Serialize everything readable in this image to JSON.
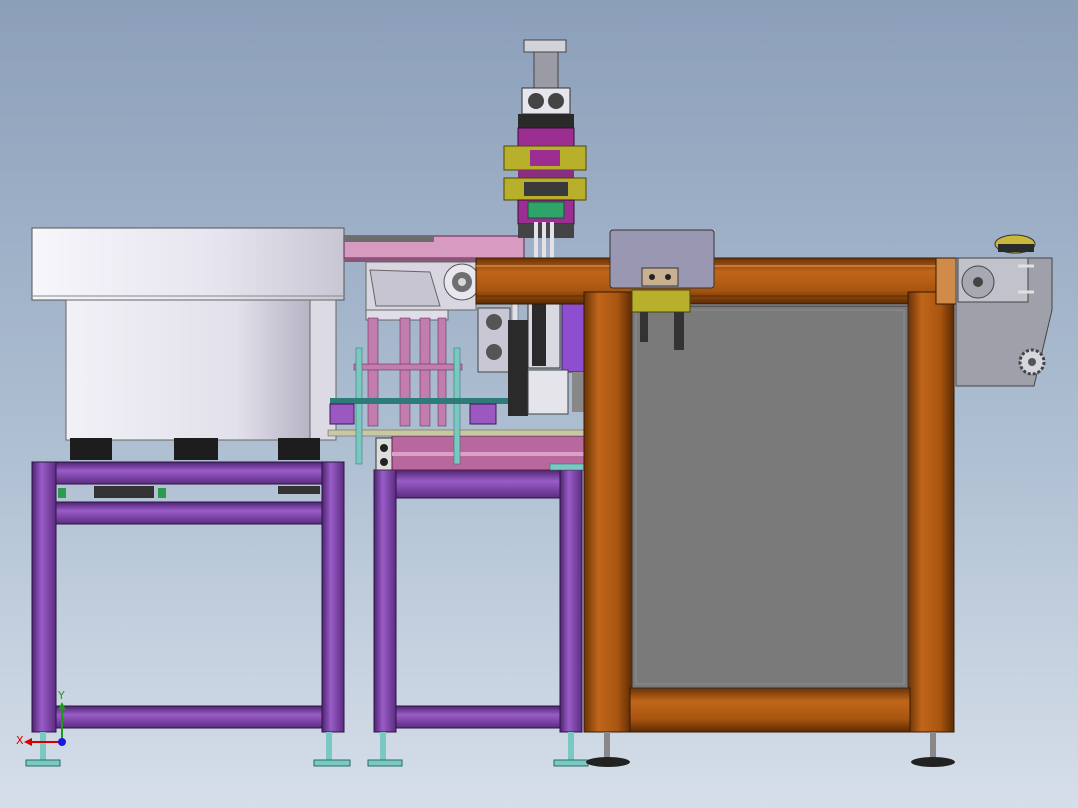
{
  "viewport": {
    "background_top": "#8c9fba",
    "background_bottom": "#d6dfe9"
  },
  "colors": {
    "purple_frame": "#8a4fb8",
    "purple_dark": "#3a1a55",
    "wood_frame": "#b05a12",
    "wood_dark": "#5a2a05",
    "bowl": "#eceaf2",
    "pink_rail": "#c27dac",
    "magenta": "#9c2d91",
    "yellow_olive": "#b8b02a",
    "green_part": "#2ea36a",
    "panel_gray": "#7a7a7a",
    "lavender": "#8d4fd0",
    "teal": "#79c8c1"
  },
  "triad": {
    "x_label": "X",
    "y_label": "Y",
    "x_color": "#d40000",
    "y_color": "#1b9a1b",
    "z_color": "#1a1adf"
  }
}
